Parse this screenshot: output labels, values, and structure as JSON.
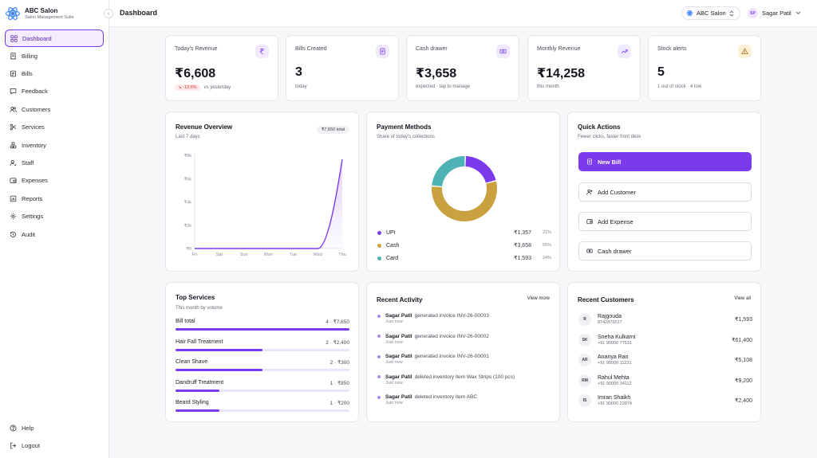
{
  "brand": {
    "name": "ABC Salon",
    "subtitle": "Salon Management Suite",
    "logo_icon": "atom-icon"
  },
  "sidebar": {
    "collapse_glyph": "‹",
    "items": [
      {
        "label": "Dashboard",
        "icon": "grid-icon",
        "active": true
      },
      {
        "label": "Billing",
        "icon": "receipt-icon"
      },
      {
        "label": "Bills",
        "icon": "bills-icon"
      },
      {
        "label": "Feedback",
        "icon": "message-icon"
      },
      {
        "label": "Customers",
        "icon": "users-icon"
      },
      {
        "label": "Services",
        "icon": "scissors-icon"
      },
      {
        "label": "Inventory",
        "icon": "boxes-icon"
      },
      {
        "label": "Staff",
        "icon": "staff-icon"
      },
      {
        "label": "Expenses",
        "icon": "wallet-icon"
      },
      {
        "label": "Reports",
        "icon": "chart-icon"
      },
      {
        "label": "Settings",
        "icon": "gear-icon"
      },
      {
        "label": "Audit",
        "icon": "history-icon"
      }
    ],
    "bottom": [
      {
        "label": "Help",
        "icon": "help-icon"
      },
      {
        "label": "Logout",
        "icon": "logout-icon"
      }
    ]
  },
  "topbar": {
    "title": "Dashboard",
    "salon": "ABC Salon",
    "user_initials": "SP",
    "user_name": "Sagar Patil"
  },
  "stats": [
    {
      "label": "Today's Revenue",
      "value": "₹6,608",
      "badge": "↘ -13.6%",
      "sub": "vs yesterday",
      "icon": "rupee-icon",
      "icon_bg": "#efeafd"
    },
    {
      "label": "Bills Created",
      "value": "3",
      "sub": "today",
      "icon": "document-icon",
      "icon_bg": "#efeafd"
    },
    {
      "label": "Cash drawer",
      "value": "₹3,658",
      "sub": "expected · tap to manage",
      "icon": "cash-icon",
      "icon_bg": "#efeafd"
    },
    {
      "label": "Monthly Revenue",
      "value": "₹14,258",
      "sub": "this month",
      "icon": "trend-icon",
      "icon_bg": "#efeafd"
    },
    {
      "label": "Stock alerts",
      "value": "5",
      "sub": "1 out of stock · 4 low",
      "icon": "alert-icon",
      "icon_bg": "#fdf0d8"
    }
  ],
  "revenue": {
    "title": "Revenue Overview",
    "subtitle": "Last 7 days",
    "total": "₹7,650 total"
  },
  "chart_data": {
    "type": "area",
    "title": "Revenue Overview",
    "categories": [
      "Fri",
      "Sat",
      "Sun",
      "Mon",
      "Tue",
      "Wed",
      "Thu"
    ],
    "values": [
      0,
      0,
      0,
      0,
      0,
      0,
      7650
    ],
    "ytick_labels": [
      "₹0",
      "₹2k",
      "₹4k",
      "₹6k",
      "₹8k"
    ],
    "ytick_values": [
      0,
      2000,
      4000,
      6000,
      8000
    ],
    "ylim": [
      0,
      8000
    ],
    "color": "#7c3aed"
  },
  "payments": {
    "title": "Payment Methods",
    "subtitle": "Share of today's collections",
    "items": [
      {
        "name": "UPI",
        "amount": "₹1,357",
        "pct": "21%",
        "value": 1357,
        "color": "#7c3aed"
      },
      {
        "name": "Cash",
        "amount": "₹3,658",
        "pct": "55%",
        "value": 3658,
        "color": "#c9a13f"
      },
      {
        "name": "Card",
        "amount": "₹1,593",
        "pct": "24%",
        "value": 1593,
        "color": "#4fb2b5"
      }
    ]
  },
  "quick_actions": {
    "title": "Quick Actions",
    "subtitle": "Fewer clicks, faster front desk",
    "buttons": [
      {
        "label": "New Bill",
        "icon": "new-bill-icon"
      },
      {
        "label": "Add Customer",
        "icon": "add-user-icon"
      },
      {
        "label": "Add Expense",
        "icon": "expense-icon"
      },
      {
        "label": "Cash drawer",
        "icon": "cash-icon"
      }
    ]
  },
  "top_services": {
    "title": "Top Services",
    "subtitle": "This month by volume",
    "items": [
      {
        "name": "Bill total",
        "count": "4 · ₹7,650",
        "fraction": 1.0
      },
      {
        "name": "Hair Fall Treatment",
        "count": "2 · ₹2,400",
        "fraction": 0.5
      },
      {
        "name": "Clean Shave",
        "count": "2 · ₹300",
        "fraction": 0.5
      },
      {
        "name": "Dandruff Treatment",
        "count": "1 · ₹850",
        "fraction": 0.25
      },
      {
        "name": "Beard Styling",
        "count": "1 · ₹200",
        "fraction": 0.25
      }
    ]
  },
  "activity": {
    "title": "Recent Activity",
    "view_more": "View more",
    "items": [
      {
        "user": "Sagar Patil",
        "text": "generated invoice INV-26-00003",
        "time": "Just now"
      },
      {
        "user": "Sagar Patil",
        "text": "generated invoice INV-26-00002",
        "time": "Just now"
      },
      {
        "user": "Sagar Patil",
        "text": "generated invoice INV-26-00001",
        "time": "Just now"
      },
      {
        "user": "Sagar Patil",
        "text": "deleted inventory item Wax Strips (100 pcs)",
        "time": "Just now"
      },
      {
        "user": "Sagar Patil",
        "text": "deleted inventory item ABC",
        "time": "Just now"
      }
    ]
  },
  "customers": {
    "title": "Recent Customers",
    "view_all": "View all",
    "items": [
      {
        "initials": "R",
        "name": "Rajgouda",
        "phone": "8742875527",
        "amount": "₹1,593"
      },
      {
        "initials": "SK",
        "name": "Sneha Kulkarni",
        "phone": "+91 90000 77531",
        "amount": "₹61,400"
      },
      {
        "initials": "AR",
        "name": "Ananya Rao",
        "phone": "+91 90000 11221",
        "amount": "₹5,108"
      },
      {
        "initials": "RM",
        "name": "Rahul Mehta",
        "phone": "+91 90000 34112",
        "amount": "₹9,200"
      },
      {
        "initials": "IS",
        "name": "Imran Shaikh",
        "phone": "+91 90000 22874",
        "amount": "₹2,400"
      }
    ]
  }
}
